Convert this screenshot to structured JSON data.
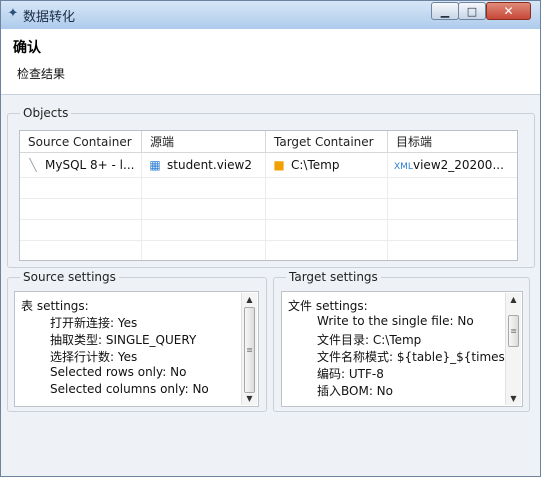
{
  "window": {
    "title": "数据转化",
    "app_icon": "data-transfer-icon"
  },
  "header": {
    "title": "确认",
    "subtitle": "检查结果"
  },
  "objects": {
    "group_title": "Objects",
    "columns": [
      "Source Container",
      "源端",
      "Target Container",
      "目标端"
    ],
    "rows": [
      {
        "source_container": "MySQL 8+ - l...",
        "source_container_icon": "mysql-icon",
        "source": "student.view2",
        "source_icon": "table-icon",
        "target_container": "C:\\Temp",
        "target_container_icon": "folder-icon",
        "target": "view2_20200...",
        "target_icon": "xml-file-icon"
      }
    ]
  },
  "source_settings": {
    "group_title": "Source settings",
    "header": "表 settings:",
    "lines": [
      "打开新连接: Yes",
      "抽取类型: SINGLE_QUERY",
      "选择行计数: Yes",
      "Selected rows only: No",
      "Selected columns only: No"
    ]
  },
  "target_settings": {
    "group_title": "Target settings",
    "header": "文件 settings:",
    "lines": [
      "Write to the single file: No",
      "文件目录: C:\\Temp",
      "文件名称模式: ${table}_${timest",
      "编码: UTF-8",
      "插入BOM: No"
    ]
  },
  "colors": {
    "title_bar": "#aecbeb",
    "background": "#eef1f5",
    "close_button": "#c74839",
    "folder": "#f0a000",
    "table_icon": "#2f7fd1"
  }
}
